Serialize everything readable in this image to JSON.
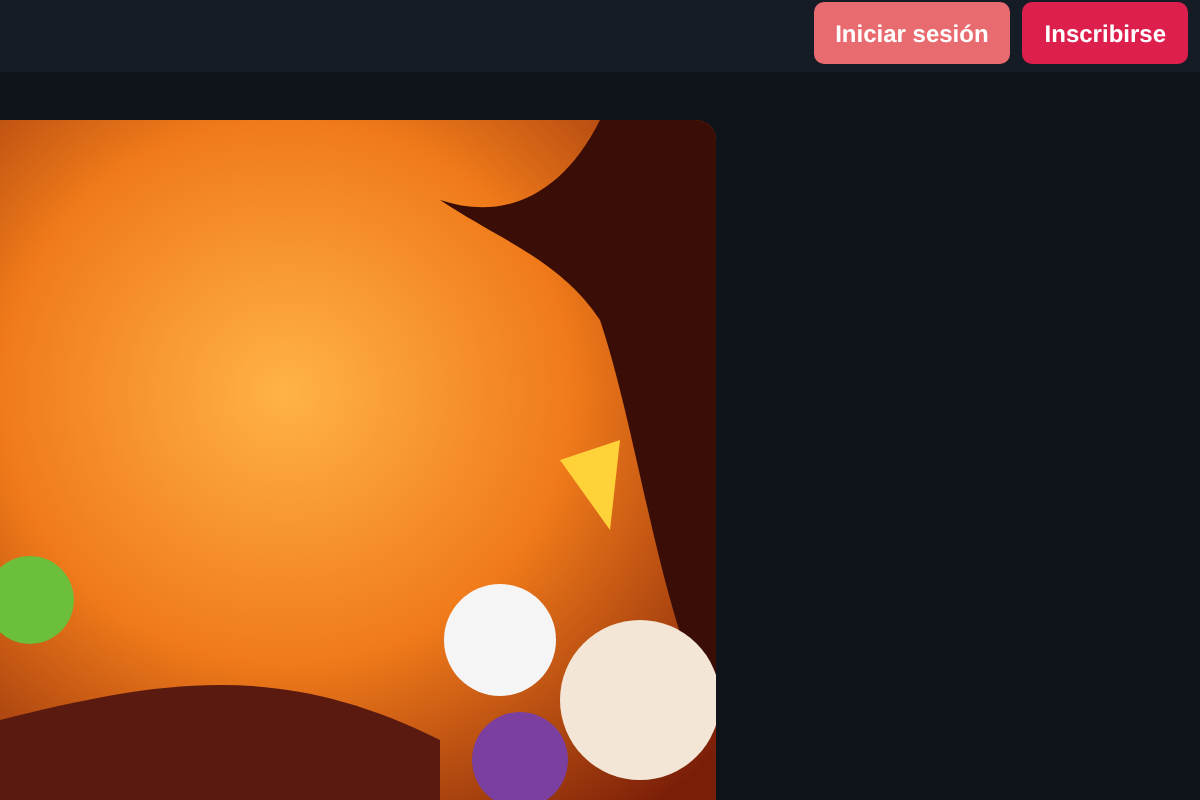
{
  "header": {
    "buttons": [
      {
        "label": "Iniciar sesión",
        "kind": "secondary"
      },
      {
        "label": "Inscribirse",
        "kind": "primary"
      }
    ]
  },
  "banner": {
    "kind": "illustration"
  }
}
